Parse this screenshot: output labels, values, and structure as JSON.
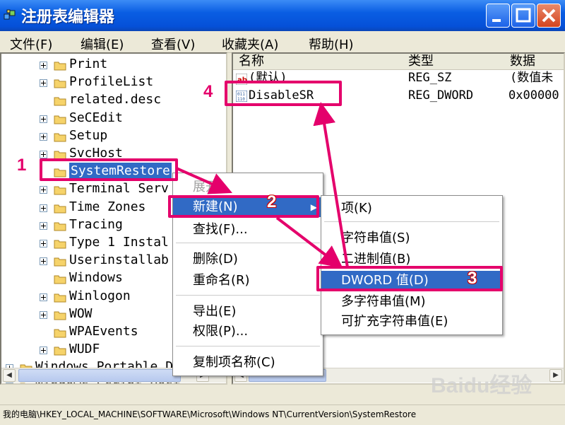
{
  "window": {
    "title": "注册表编辑器",
    "buttons": {
      "minimize": "minimize-icon",
      "maximize": "maximize-icon",
      "close": "close-icon"
    }
  },
  "menubar": [
    "文件(F)",
    "编辑(E)",
    "查看(V)",
    "收藏夹(A)",
    "帮助(H)"
  ],
  "tree": {
    "nodes": [
      {
        "label": "Print",
        "expandable": true
      },
      {
        "label": "ProfileList",
        "expandable": true
      },
      {
        "label": "related.desc",
        "expandable": false
      },
      {
        "label": "SeCEdit",
        "expandable": true
      },
      {
        "label": "Setup",
        "expandable": true
      },
      {
        "label": "SvcHost",
        "expandable": true
      },
      {
        "label": "SystemRestore",
        "expandable": false,
        "selected": true
      },
      {
        "label": "Terminal Serv",
        "expandable": true
      },
      {
        "label": "Time Zones",
        "expandable": true
      },
      {
        "label": "Tracing",
        "expandable": true
      },
      {
        "label": "Type 1 Instal",
        "expandable": true
      },
      {
        "label": "Userinstallab",
        "expandable": true
      },
      {
        "label": "Windows",
        "expandable": false
      },
      {
        "label": "Winlogon",
        "expandable": true
      },
      {
        "label": "WOW",
        "expandable": true
      },
      {
        "label": "WPAEvents",
        "expandable": false
      },
      {
        "label": "WUDF",
        "expandable": true
      }
    ],
    "lower_nodes": [
      {
        "label": "Windows Portable D"
      },
      {
        "label": "Windows Script Host"
      }
    ]
  },
  "list": {
    "columns": [
      "名称",
      "类型",
      "数据"
    ],
    "rows": [
      {
        "name": "(默认)",
        "type": "REG_SZ",
        "data": "(数值未",
        "icon": "string-value-icon"
      },
      {
        "name": "DisableSR",
        "type": "REG_DWORD",
        "data": "0x00000",
        "icon": "dword-value-icon"
      }
    ]
  },
  "context_menu": {
    "items": [
      "展开",
      "新建(N)",
      "查找(F)...",
      "删除(D)",
      "重命名(R)",
      "导出(E)",
      "权限(P)...",
      "复制项名称(C)"
    ]
  },
  "submenu": {
    "items": [
      "项(K)",
      "字符串值(S)",
      "二进制值(B)",
      "DWORD 值(D)",
      "多字符串值(M)",
      "可扩充字符串值(E)"
    ]
  },
  "annotations": {
    "step1": "1",
    "step2": "2",
    "step3": "3",
    "step4": "4",
    "color": "#e4006b"
  },
  "statusbar": "我的电脑\\HKEY_LOCAL_MACHINE\\SOFTWARE\\Microsoft\\Windows NT\\CurrentVersion\\SystemRestore",
  "watermark": "Baidu经验"
}
